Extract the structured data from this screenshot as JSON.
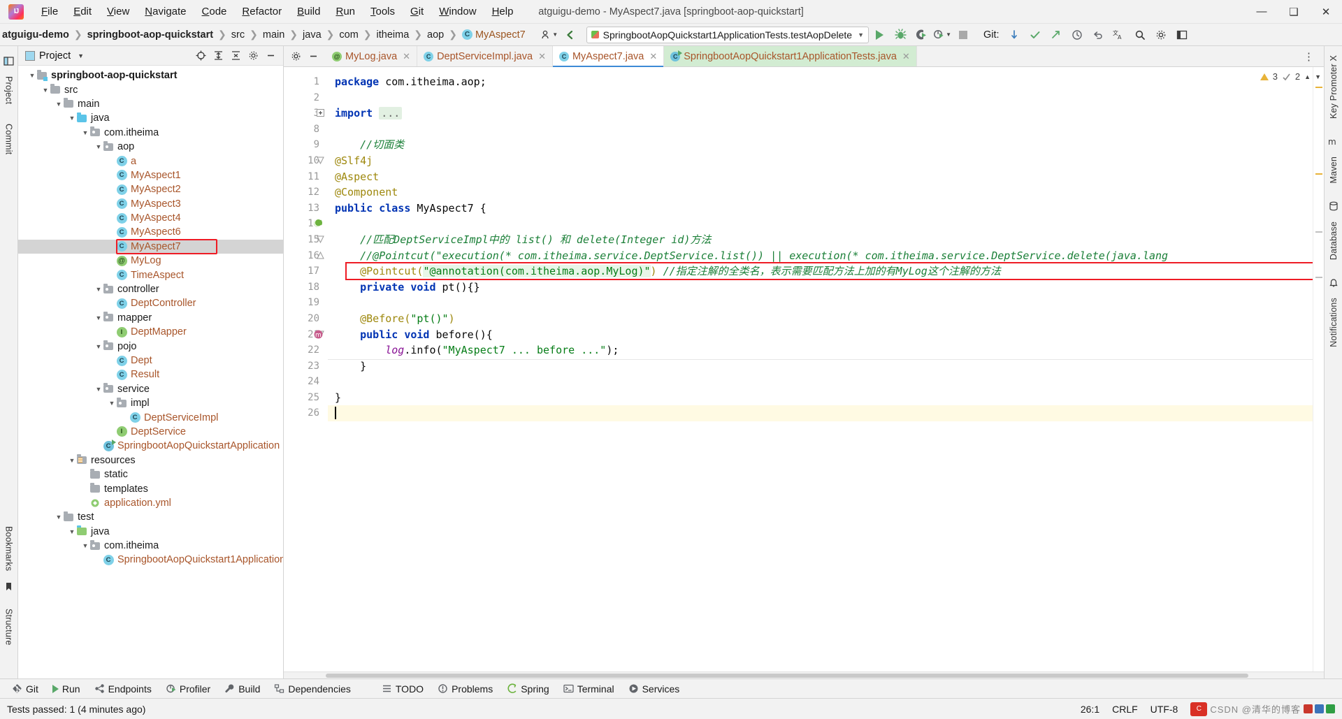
{
  "window": {
    "title": "atguigu-demo - MyAspect7.java [springboot-aop-quickstart]",
    "minimize": "—",
    "maximize": "❑",
    "close": "✕"
  },
  "menubar": {
    "items": [
      "File",
      "Edit",
      "View",
      "Navigate",
      "Code",
      "Refactor",
      "Build",
      "Run",
      "Tools",
      "Git",
      "Window",
      "Help"
    ]
  },
  "breadcrumb": {
    "items": [
      "atguigu-demo",
      "springboot-aop-quickstart",
      "src",
      "main",
      "java",
      "com",
      "itheima",
      "aop",
      "MyAspect7"
    ]
  },
  "toolbar": {
    "run_config": "SpringbootAopQuickstart1ApplicationTests.testAopDelete",
    "git_label": "Git:",
    "run_title": "Run",
    "debug_title": "Debug",
    "coverage_title": "Run with Coverage",
    "profile_title": "Profiler",
    "stop_title": "Stop"
  },
  "project_panel": {
    "title": "Project",
    "tree": [
      {
        "depth": 0,
        "label": "springboot-aop-quickstart",
        "icon": "module-folder",
        "arrow": "down",
        "bold": true
      },
      {
        "depth": 1,
        "label": "src",
        "icon": "folder",
        "arrow": "down"
      },
      {
        "depth": 2,
        "label": "main",
        "icon": "folder",
        "arrow": "down"
      },
      {
        "depth": 3,
        "label": "java",
        "icon": "source-folder",
        "arrow": "down"
      },
      {
        "depth": 4,
        "label": "com.itheima",
        "icon": "package",
        "arrow": "down"
      },
      {
        "depth": 5,
        "label": "aop",
        "icon": "package",
        "arrow": "down"
      },
      {
        "depth": 6,
        "label": "a",
        "icon": "class",
        "arrow": "none"
      },
      {
        "depth": 6,
        "label": "MyAspect1",
        "icon": "class",
        "arrow": "none"
      },
      {
        "depth": 6,
        "label": "MyAspect2",
        "icon": "class",
        "arrow": "none"
      },
      {
        "depth": 6,
        "label": "MyAspect3",
        "icon": "class",
        "arrow": "none"
      },
      {
        "depth": 6,
        "label": "MyAspect4",
        "icon": "class",
        "arrow": "none"
      },
      {
        "depth": 6,
        "label": "MyAspect6",
        "icon": "class",
        "arrow": "none"
      },
      {
        "depth": 6,
        "label": "MyAspect7",
        "icon": "class",
        "arrow": "none",
        "selected": true,
        "highlight": true
      },
      {
        "depth": 6,
        "label": "MyLog",
        "icon": "annotation",
        "arrow": "none"
      },
      {
        "depth": 6,
        "label": "TimeAspect",
        "icon": "class",
        "arrow": "none"
      },
      {
        "depth": 5,
        "label": "controller",
        "icon": "package",
        "arrow": "down"
      },
      {
        "depth": 6,
        "label": "DeptController",
        "icon": "class",
        "arrow": "none"
      },
      {
        "depth": 5,
        "label": "mapper",
        "icon": "package",
        "arrow": "down"
      },
      {
        "depth": 6,
        "label": "DeptMapper",
        "icon": "interface",
        "arrow": "none"
      },
      {
        "depth": 5,
        "label": "pojo",
        "icon": "package",
        "arrow": "down"
      },
      {
        "depth": 6,
        "label": "Dept",
        "icon": "class",
        "arrow": "none"
      },
      {
        "depth": 6,
        "label": "Result",
        "icon": "class",
        "arrow": "none"
      },
      {
        "depth": 5,
        "label": "service",
        "icon": "package",
        "arrow": "down"
      },
      {
        "depth": 6,
        "label": "impl",
        "icon": "package",
        "arrow": "down"
      },
      {
        "depth": 7,
        "label": "DeptServiceImpl",
        "icon": "class",
        "arrow": "none"
      },
      {
        "depth": 6,
        "label": "DeptService",
        "icon": "interface",
        "arrow": "none"
      },
      {
        "depth": 5,
        "label": "SpringbootAopQuickstartApplication",
        "icon": "springboot-class",
        "arrow": "none"
      },
      {
        "depth": 3,
        "label": "resources",
        "icon": "resource-folder",
        "arrow": "down"
      },
      {
        "depth": 4,
        "label": "static",
        "icon": "folder",
        "arrow": "none"
      },
      {
        "depth": 4,
        "label": "templates",
        "icon": "folder",
        "arrow": "none"
      },
      {
        "depth": 4,
        "label": "application.yml",
        "icon": "yml",
        "arrow": "none"
      },
      {
        "depth": 2,
        "label": "test",
        "icon": "folder",
        "arrow": "down"
      },
      {
        "depth": 3,
        "label": "java",
        "icon": "source-folder-test",
        "arrow": "down"
      },
      {
        "depth": 4,
        "label": "com.itheima",
        "icon": "package",
        "arrow": "down"
      },
      {
        "depth": 5,
        "label": "SpringbootAopQuickstart1ApplicationTests",
        "icon": "class",
        "arrow": "none"
      }
    ]
  },
  "left_strip": {
    "tabs": [
      "Project",
      "Commit",
      "Bookmarks",
      "Structure"
    ]
  },
  "right_strip": {
    "tabs": [
      "Key Promoter X",
      "Maven",
      "Database",
      "Notifications"
    ]
  },
  "editor_tabs": [
    {
      "label": "MyLog.java",
      "icon": "annotation",
      "active": false
    },
    {
      "label": "DeptServiceImpl.java",
      "icon": "class",
      "active": false
    },
    {
      "label": "MyAspect7.java",
      "icon": "class",
      "active": true
    },
    {
      "label": "SpringbootAopQuickstart1ApplicationTests.java",
      "icon": "springboot-test-class",
      "active": false,
      "green": true
    }
  ],
  "inspection": {
    "warnings": "3",
    "weak_warnings": "2"
  },
  "code": {
    "first_line": 1,
    "lines": [
      {
        "n": "1",
        "segs": [
          {
            "t": "package ",
            "c": "k"
          },
          {
            "t": "com.itheima.aop;",
            "c": "plain"
          }
        ]
      },
      {
        "n": "2",
        "segs": []
      },
      {
        "n": "3",
        "segs": [
          {
            "t": "import ",
            "c": "k"
          },
          {
            "t": "...",
            "c": "importdots"
          }
        ],
        "fold": "plus"
      },
      {
        "n": "8",
        "segs": []
      },
      {
        "n": "9",
        "segs": [
          {
            "t": "    //切面类",
            "c": "cmt-green"
          }
        ]
      },
      {
        "n": "10",
        "segs": [
          {
            "t": "@Slf4j",
            "c": "ann"
          }
        ],
        "fold": "down"
      },
      {
        "n": "11",
        "segs": [
          {
            "t": "@Aspect",
            "c": "ann"
          }
        ]
      },
      {
        "n": "12",
        "segs": [
          {
            "t": "@Component",
            "c": "ann"
          }
        ]
      },
      {
        "n": "13",
        "segs": [
          {
            "t": "public ",
            "c": "k"
          },
          {
            "t": "class ",
            "c": "k"
          },
          {
            "t": "MyAspect7 {",
            "c": "plain"
          }
        ],
        "gico": "spring-bean"
      },
      {
        "n": "14",
        "segs": []
      },
      {
        "n": "15",
        "segs": [
          {
            "t": "    //匹配DeptServiceImpl中的 list() 和 delete(Integer id)方法",
            "c": "cmt-green"
          }
        ],
        "fold": "down"
      },
      {
        "n": "16",
        "segs": [
          {
            "t": "    //@Pointcut(\"execution(* com.itheima.service.DeptService.list()) || execution(* com.itheima.service.DeptService.delete(java.lang",
            "c": "cmt-green"
          }
        ],
        "fold": "up"
      },
      {
        "n": "17",
        "segs": [
          {
            "t": "    @Pointcut(",
            "c": "ann"
          },
          {
            "t": "\"@annotation(com.itheima.aop.MyLog)\"",
            "c": "str hl-str"
          },
          {
            "t": ") ",
            "c": "ann"
          },
          {
            "t": "//指定注解的全类名，表示需要匹配方法上加的有MyLog这个注解的方法",
            "c": "cmt-green"
          }
        ],
        "redbox": true
      },
      {
        "n": "18",
        "segs": [
          {
            "t": "    private ",
            "c": "k"
          },
          {
            "t": "void ",
            "c": "k"
          },
          {
            "t": "pt(){}",
            "c": "plain"
          }
        ]
      },
      {
        "n": "19",
        "segs": []
      },
      {
        "n": "20",
        "segs": [
          {
            "t": "    @Before(",
            "c": "ann"
          },
          {
            "t": "\"pt()\"",
            "c": "str"
          },
          {
            "t": ")",
            "c": "ann"
          }
        ]
      },
      {
        "n": "21",
        "segs": [
          {
            "t": "    public ",
            "c": "k"
          },
          {
            "t": "void ",
            "c": "k"
          },
          {
            "t": "before(){",
            "c": "plain"
          }
        ],
        "gico": "aop-marker",
        "fold": "down"
      },
      {
        "n": "22",
        "segs": [
          {
            "t": "        log",
            "c": "fld"
          },
          {
            "t": ".info(",
            "c": "plain"
          },
          {
            "t": "\"MyAspect7 ... before ...\"",
            "c": "str"
          },
          {
            "t": ");",
            "c": "plain"
          }
        ]
      },
      {
        "n": "23",
        "segs": [
          {
            "t": "    }",
            "c": "plain"
          }
        ]
      },
      {
        "n": "24",
        "segs": []
      },
      {
        "n": "25",
        "segs": [
          {
            "t": "}",
            "c": "plain"
          }
        ]
      },
      {
        "n": "26",
        "segs": [],
        "caret": true,
        "current": true
      }
    ]
  },
  "tool_windows": [
    {
      "label": "Git",
      "icon": "git-icon"
    },
    {
      "label": "Run",
      "icon": "run-icon"
    },
    {
      "label": "Endpoints",
      "icon": "endpoints-icon"
    },
    {
      "label": "Profiler",
      "icon": "profiler-icon"
    },
    {
      "label": "Build",
      "icon": "build-icon"
    },
    {
      "label": "Dependencies",
      "icon": "dependencies-icon"
    },
    {
      "label": "TODO",
      "icon": "todo-icon"
    },
    {
      "label": "Problems",
      "icon": "problems-icon"
    },
    {
      "label": "Spring",
      "icon": "spring-icon"
    },
    {
      "label": "Terminal",
      "icon": "terminal-icon"
    },
    {
      "label": "Services",
      "icon": "services-icon"
    }
  ],
  "status": {
    "message": "Tests passed: 1 (4 minutes ago)",
    "caret_position": "26:1",
    "line_separator": "CRLF",
    "encoding": "UTF-8",
    "watermark": "CSDN @清华的博客"
  }
}
